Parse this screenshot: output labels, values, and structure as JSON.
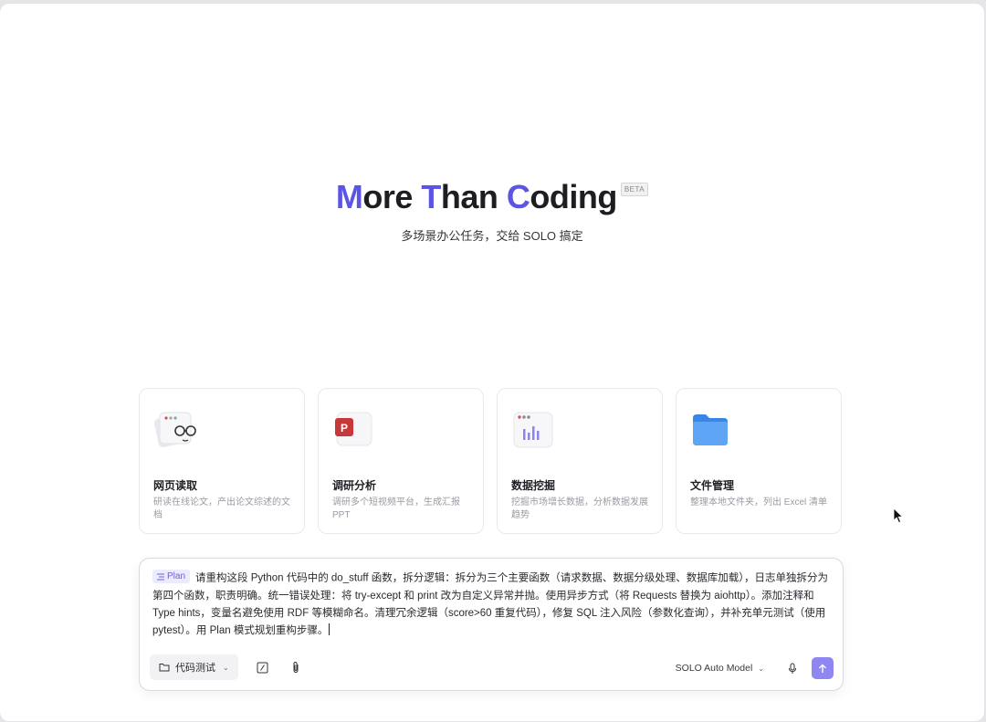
{
  "hero": {
    "title_parts": [
      {
        "text": "M",
        "accent": true
      },
      {
        "text": "ore ",
        "accent": false
      },
      {
        "text": "T",
        "accent": true
      },
      {
        "text": "han ",
        "accent": false
      },
      {
        "text": "C",
        "accent": true
      },
      {
        "text": "oding",
        "accent": false
      }
    ],
    "badge": "BETA",
    "subtitle": "多场景办公任务，交给 SOLO 搞定"
  },
  "cards": [
    {
      "icon": "web-reading-icon",
      "title": "网页读取",
      "desc": "研读在线论文，产出论文综述的文档"
    },
    {
      "icon": "ppt-icon",
      "title": "调研分析",
      "desc": "调研多个短视频平台，生成汇报PPT"
    },
    {
      "icon": "chart-icon",
      "title": "数据挖掘",
      "desc": "挖掘市场增长数据，分析数据发展趋势"
    },
    {
      "icon": "folder-icon",
      "title": "文件管理",
      "desc": "整理本地文件夹，列出 Excel 清单"
    }
  ],
  "composer": {
    "mode_chip": "Plan",
    "prompt_text": "请重构这段 Python 代码中的 do_stuff 函数，拆分逻辑：拆分为三个主要函数（请求数据、数据分级处理、数据库加载），日志单独拆分为第四个函数，职责明确。统一错误处理：将 try-except 和 print 改为自定义异常并抛。使用异步方式（将 Requests 替换为 aiohttp）。添加注释和 Type hints，变量名避免使用 RDF 等模糊命名。清理冗余逻辑（score>60 重复代码），修复 SQL 注入风险（参数化查询），并补充单元测试（使用 pytest）。用 Plan 模式规划重构步骤。",
    "project_label": "代码测试",
    "model_label": "SOLO Auto Model"
  },
  "colors": {
    "accent": "#5b54e6",
    "send_button": "#8f86f2",
    "chip_bg": "#ecebfb"
  }
}
